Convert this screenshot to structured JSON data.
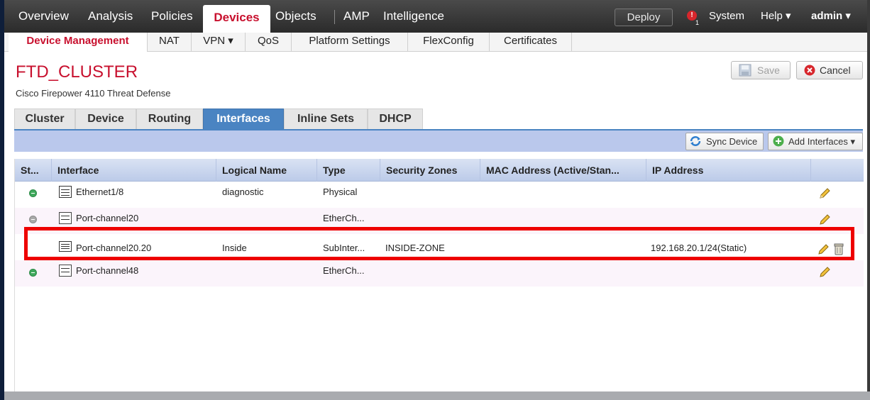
{
  "topnav": {
    "items": [
      "Overview",
      "Analysis",
      "Policies",
      "Devices",
      "Objects",
      "AMP",
      "Intelligence"
    ],
    "deploy": "Deploy",
    "alert_count": "1",
    "system": "System",
    "help": "Help ▾",
    "user": "admin ▾"
  },
  "subnav": [
    "Device Management",
    "NAT",
    "VPN ▾",
    "QoS",
    "Platform Settings",
    "FlexConfig",
    "Certificates"
  ],
  "page": {
    "title": "FTD_CLUSTER",
    "subtitle": "Cisco Firepower 4110 Threat Defense",
    "save": "Save",
    "cancel": "Cancel"
  },
  "tabs": [
    "Cluster",
    "Device",
    "Routing",
    "Interfaces",
    "Inline Sets",
    "DHCP"
  ],
  "toolbar": {
    "sync": "Sync Device",
    "add": "Add Interfaces ▾"
  },
  "table": {
    "headers": [
      "St...",
      "Interface",
      "Logical Name",
      "Type",
      "Security Zones",
      "MAC Address (Active/Stan...",
      "IP Address"
    ],
    "rows": [
      {
        "status": "green",
        "interface": "Ethernet1/8",
        "logical": "diagnostic",
        "type": "Physical",
        "zone": "",
        "mac": "",
        "ip": ""
      },
      {
        "status": "gray",
        "interface": "Port-channel20",
        "logical": "",
        "type": "EtherCh...",
        "zone": "",
        "mac": "",
        "ip": ""
      },
      {
        "status": "",
        "interface": "Port-channel20.20",
        "logical": "Inside",
        "type": "SubInter...",
        "zone": "INSIDE-ZONE",
        "mac": "",
        "ip": "192.168.20.1/24(Static)"
      },
      {
        "status": "green",
        "interface": "Port-channel48",
        "logical": "",
        "type": "EtherCh...",
        "zone": "",
        "mac": "",
        "ip": ""
      }
    ]
  },
  "colors": {
    "brand_red": "#c8102e",
    "tab_blue": "#4a84c2",
    "highlight": "#ee0000"
  }
}
